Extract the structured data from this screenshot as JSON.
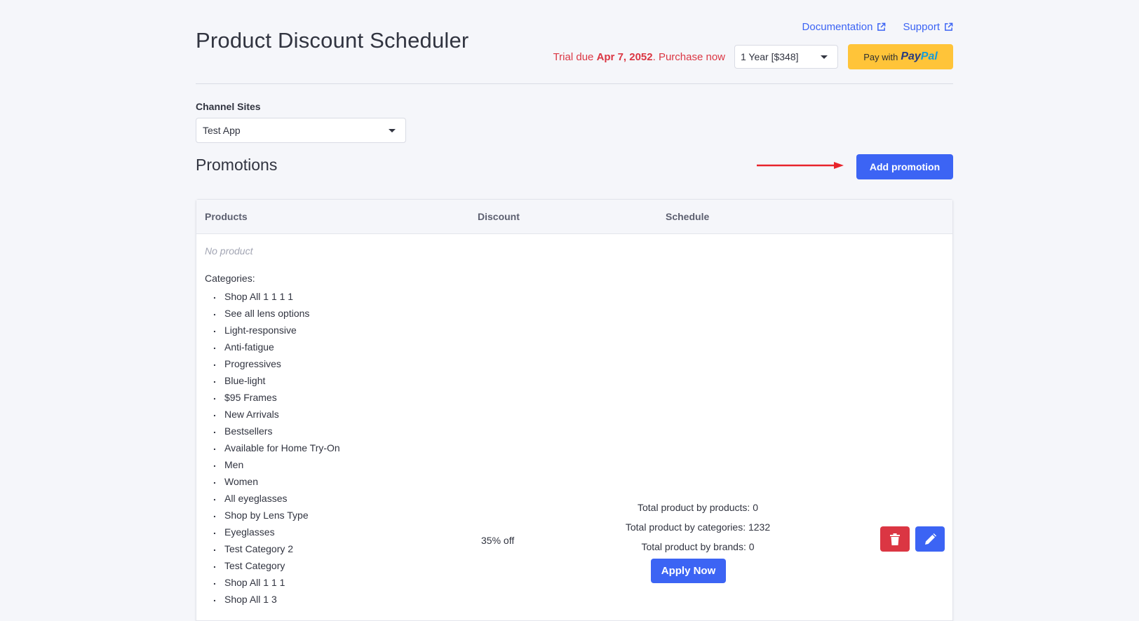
{
  "header": {
    "title": "Product Discount Scheduler",
    "links": [
      {
        "label": "Documentation",
        "icon": "external-link-icon"
      },
      {
        "label": "Support",
        "icon": "external-link-icon"
      }
    ],
    "trial": {
      "prefix": "Trial due ",
      "date": "Apr 7, 2052",
      "suffix": ". Purchase now"
    },
    "plan_select": {
      "value": "1 Year [$348]"
    },
    "paypal": {
      "prefix": "Pay with",
      "brand_a": "Pay",
      "brand_b": "Pal"
    }
  },
  "channel": {
    "label": "Channel Sites",
    "value": "Test App"
  },
  "promotions": {
    "title": "Promotions",
    "add_label": "Add promotion",
    "columns": [
      "Products",
      "Discount",
      "Schedule"
    ],
    "row": {
      "no_product": "No product",
      "categories_label": "Categories:",
      "categories": [
        "Shop All 1 1 1 1",
        "See all lens options",
        "Light-responsive",
        "Anti-fatigue",
        "Progressives",
        "Blue-light",
        "$95 Frames",
        "New Arrivals",
        "Bestsellers",
        "Available for Home Try-On",
        "Men",
        "Women",
        "All eyeglasses",
        "Shop by Lens Type",
        "Eyeglasses",
        "Test Category 2",
        "Test Category",
        "Shop All 1 1 1",
        "Shop All 1 3"
      ],
      "discount": "35% off",
      "schedule": {
        "by_products": "Total product by products: 0",
        "by_categories": "Total product by categories: 1232",
        "by_brands": "Total product by brands: 0",
        "apply_label": "Apply Now"
      }
    }
  },
  "colors": {
    "primary": "#3c64f4",
    "danger": "#db3643",
    "paypal": "#ffc439",
    "annotation_arrow": "#e8242b"
  }
}
